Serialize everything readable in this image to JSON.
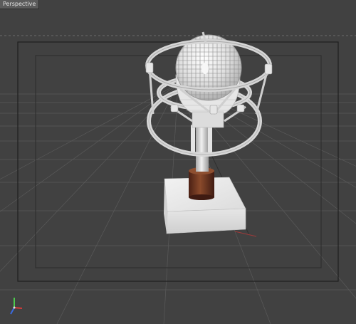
{
  "viewport": {
    "label": "Perspective",
    "background": "#414141",
    "grid_color": "#5a5a5a",
    "frame_color": "#1e1e1e",
    "safe_frame_color": "#2a2a2a"
  },
  "model": {
    "icon": "microphone-model",
    "body_color": "#d9d9d9",
    "base_color": "#e8e8e8",
    "collar_color": "#7a3d24"
  },
  "axis_gizmo": {
    "icon": "axis-gizmo-icon",
    "colors": {
      "x": "#d83a3a",
      "y": "#4cc94c",
      "z": "#3a6ae0"
    }
  }
}
